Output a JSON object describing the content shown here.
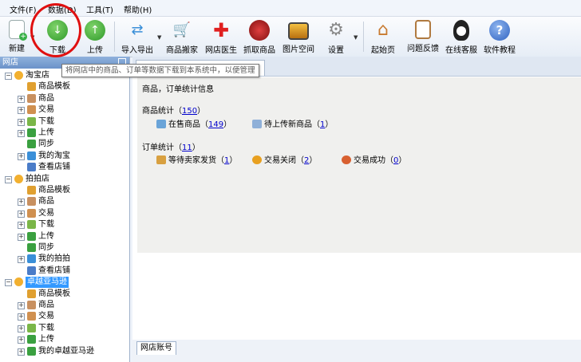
{
  "menu": [
    {
      "label": "文件(F)"
    },
    {
      "label": "数据(D)"
    },
    {
      "label": "工具(T)"
    },
    {
      "label": "帮助(H)"
    }
  ],
  "toolbar": {
    "new": "新建",
    "download": "下载",
    "upload": "上传",
    "import_export": "导入导出",
    "product_move": "商品搬家",
    "shop_doctor": "网店医生",
    "grab_product": "抓取商品",
    "image_space": "图片空间",
    "settings": "设置",
    "home": "起始页",
    "feedback": "问题反馈",
    "online_service": "在线客服",
    "tutorial": "软件教程"
  },
  "left_panel": {
    "title": "网店",
    "tree": [
      {
        "label": "淘宝店",
        "level": 0
      },
      {
        "label": "商品模板",
        "level": 1
      },
      {
        "label": "商品",
        "level": 1
      },
      {
        "label": "交易",
        "level": 1
      },
      {
        "label": "下载",
        "level": 1
      },
      {
        "label": "上传",
        "level": 1
      },
      {
        "label": "同步",
        "level": 1
      },
      {
        "label": "我的淘宝",
        "level": 1
      },
      {
        "label": "查看店铺",
        "level": 1
      },
      {
        "label": "拍拍店",
        "level": 0
      },
      {
        "label": "商品模板",
        "level": 1
      },
      {
        "label": "商品",
        "level": 1
      },
      {
        "label": "交易",
        "level": 1
      },
      {
        "label": "下载",
        "level": 1
      },
      {
        "label": "上传",
        "level": 1
      },
      {
        "label": "同步",
        "level": 1
      },
      {
        "label": "我的拍拍",
        "level": 1
      },
      {
        "label": "查看店铺",
        "level": 1
      },
      {
        "label": "卓越亚马逊",
        "level": 0,
        "selected": true
      },
      {
        "label": "商品模板",
        "level": 1
      },
      {
        "label": "商品",
        "level": 1
      },
      {
        "label": "交易",
        "level": 1
      },
      {
        "label": "下载",
        "level": 1
      },
      {
        "label": "上传",
        "level": 1
      },
      {
        "label": "我的卓越亚马逊",
        "level": 1
      }
    ]
  },
  "tooltip": "将网店中的商品、订单等数据下载到本系统中，以便管理",
  "main": {
    "header": "商品，订单统计信息",
    "product_stats": {
      "label": "商品统计",
      "total": "150"
    },
    "on_sale": {
      "label": "在售商品",
      "count": "149"
    },
    "pending_upload": {
      "label": "待上传新商品",
      "count": "1"
    },
    "order_stats": {
      "label": "订单统计",
      "total": "11"
    },
    "awaiting_ship": {
      "label": "等待卖家发货",
      "count": "1"
    },
    "closed": {
      "label": "交易关闭",
      "count": "2"
    },
    "success": {
      "label": "交易成功",
      "count": "0"
    },
    "bottom_tab": "网店账号"
  }
}
